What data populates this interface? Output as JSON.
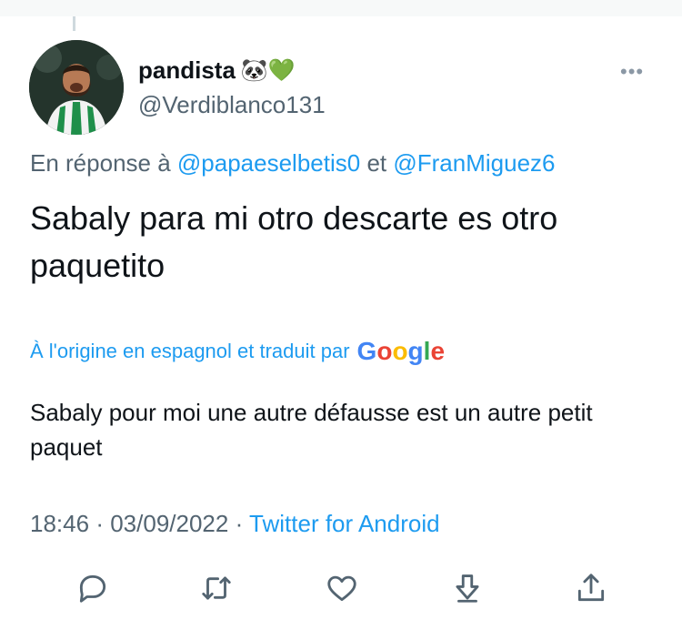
{
  "tweet": {
    "display_name": "pandista",
    "name_emojis": "🐼💚",
    "handle": "@Verdiblanco131",
    "more_label": "•••",
    "reply_prefix": "En réponse à",
    "reply_mention_1": "@papaeselbetis0",
    "reply_conjunction": "et",
    "reply_mention_2": "@FranMiguez6",
    "text": "Sabaly para mi otro descarte es otro paquetito",
    "translation_notice": "À l'origine en espagnol et traduit par",
    "translation_provider": "Google",
    "translated_text": "Sabaly pour moi une autre défausse est un autre petit paquet",
    "time": "18:46",
    "date": "03/09/2022",
    "separator": "·",
    "source": "Twitter for Android"
  },
  "actions": [
    {
      "name": "reply",
      "icon": "reply-icon"
    },
    {
      "name": "retweet",
      "icon": "retweet-icon"
    },
    {
      "name": "like",
      "icon": "heart-icon"
    },
    {
      "name": "bookmark",
      "icon": "download-icon"
    },
    {
      "name": "share",
      "icon": "share-icon"
    }
  ],
  "colors": {
    "link": "#1d9bf0",
    "secondary": "#536471",
    "text": "#0f1419",
    "google_blue": "#4285F4",
    "google_red": "#EA4335",
    "google_yellow": "#FBBC05",
    "google_green": "#34A853"
  }
}
